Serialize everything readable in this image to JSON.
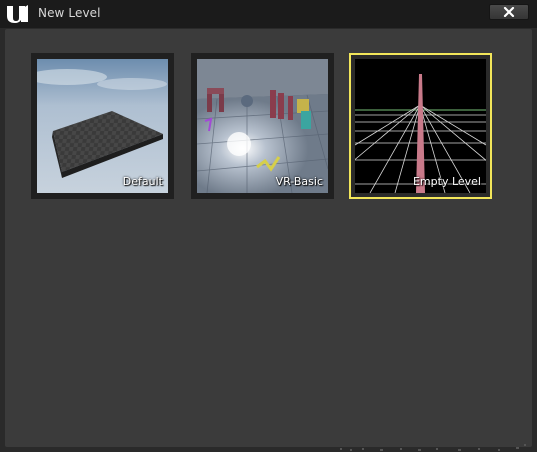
{
  "window": {
    "title": "New Level",
    "close_icon": "close-x-icon",
    "logo_icon": "unreal-engine-logo"
  },
  "templates": [
    {
      "label": "Default",
      "selected": false
    },
    {
      "label": "VR-Basic",
      "selected": false
    },
    {
      "label": "Empty Level",
      "selected": true
    }
  ],
  "colors": {
    "selection_border": "#f2e65a",
    "panel_bg": "#3b3b3b",
    "titlebar_bg": "#1b1b1b"
  }
}
